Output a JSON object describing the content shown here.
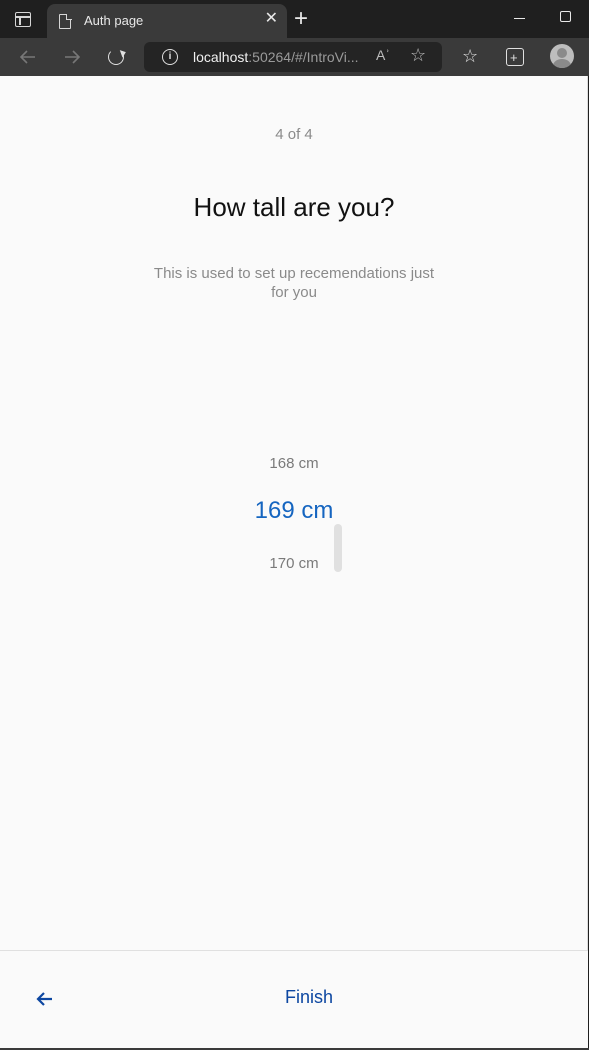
{
  "browser": {
    "tab_title": "Auth page",
    "tab_close": "✕",
    "new_tab": "+",
    "url_host": "localhost",
    "url_rest": ":50264/#/IntroVi...",
    "readaloud": "Aʾ",
    "icons": [
      "tab-actions-icon",
      "page-icon",
      "back-icon",
      "forward-icon",
      "refresh-icon",
      "info-icon",
      "read-aloud-icon",
      "add-favorite-icon",
      "favorites-icon",
      "collections-icon",
      "profile-icon"
    ]
  },
  "intro": {
    "step": "4 of 4",
    "question": "How tall are you?",
    "subtitle": "This is used to set up recemendations just for you"
  },
  "height_picker": {
    "previous": "168 cm",
    "selected": "169 cm",
    "next": "170 cm"
  },
  "footer": {
    "finish_label": "Finish"
  },
  "colors": {
    "accent": "#1565c0",
    "finish": "#0d47a1",
    "muted_text": "#8a8a8a",
    "page_bg": "#fafafa",
    "chrome_bg": "#3a3a3a"
  }
}
